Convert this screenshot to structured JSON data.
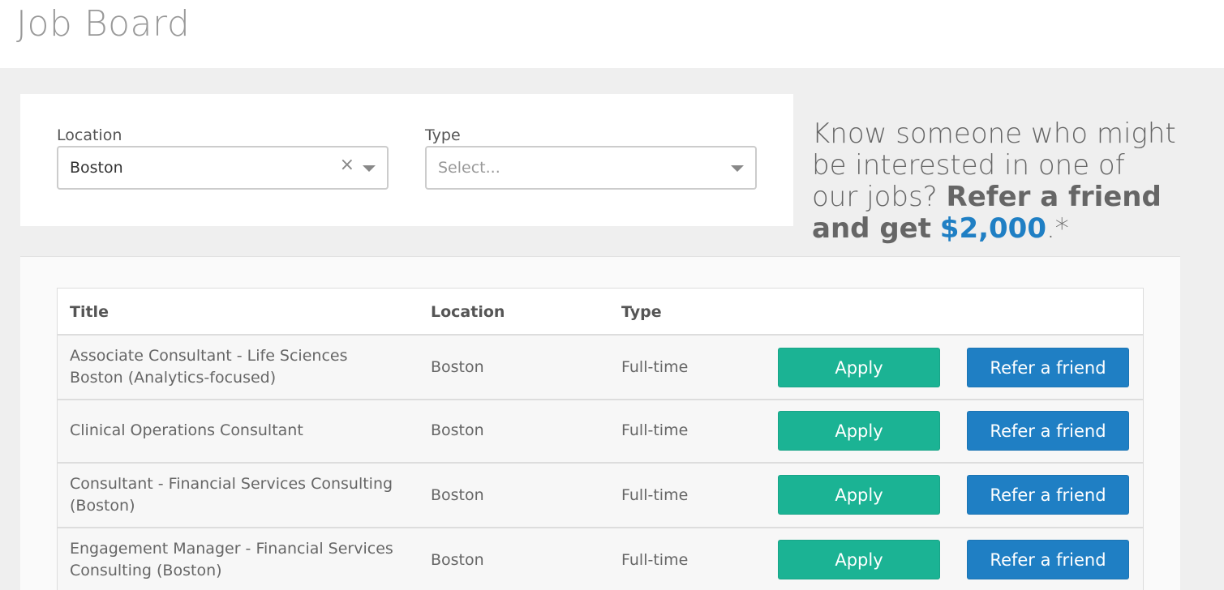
{
  "page": {
    "title": "Job Board"
  },
  "filters": {
    "location": {
      "label": "Location",
      "value": "Boston",
      "clear_icon": "×"
    },
    "type": {
      "label": "Type",
      "placeholder": "Select..."
    }
  },
  "promo": {
    "line_text": "Know someone who might be interested in one of our jobs?",
    "bold_text": "Refer a friend and get",
    "amount": "$2,000",
    "suffix": ".*"
  },
  "table": {
    "headers": {
      "title": "Title",
      "location": "Location",
      "type": "Type"
    },
    "rows": [
      {
        "title": "Associate Consultant - Life Sciences Boston (Analytics-focused)",
        "location": "Boston",
        "type": "Full-time",
        "apply": "Apply",
        "refer": "Refer a friend"
      },
      {
        "title": "Clinical Operations Consultant",
        "location": "Boston",
        "type": "Full-time",
        "apply": "Apply",
        "refer": "Refer a friend"
      },
      {
        "title": "Consultant - Financial Services Consulting (Boston)",
        "location": "Boston",
        "type": "Full-time",
        "apply": "Apply",
        "refer": "Refer a friend"
      },
      {
        "title": "Engagement Manager - Financial Services Consulting (Boston)",
        "location": "Boston",
        "type": "Full-time",
        "apply": "Apply",
        "refer": "Refer a friend"
      }
    ]
  },
  "colors": {
    "apply": "#1bb394",
    "refer": "#1f7fc4",
    "amount": "#1f7fc4"
  }
}
